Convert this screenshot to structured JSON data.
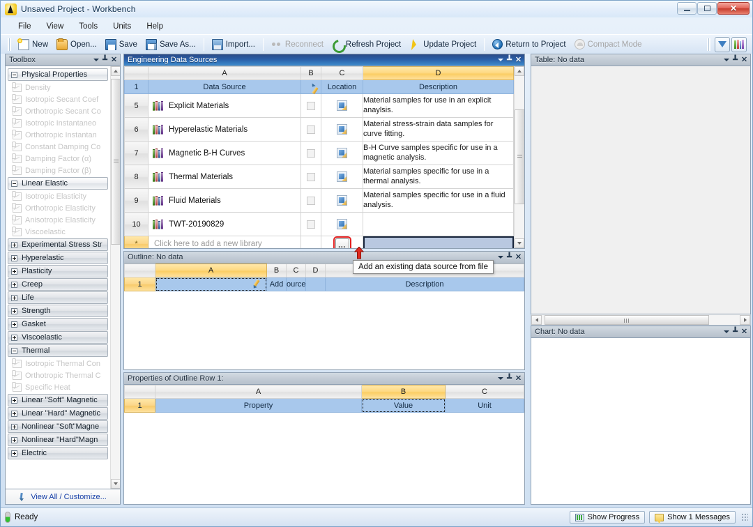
{
  "window": {
    "title": "Unsaved Project - Workbench",
    "app_icon": "workbench-logo-icon",
    "minimize": "minimize-icon",
    "maximize": "maximize-icon",
    "close": "✕"
  },
  "menu": {
    "items": [
      "File",
      "View",
      "Tools",
      "Units",
      "Help"
    ]
  },
  "toolbar": {
    "buttons": [
      {
        "label": "New",
        "icon": "new-document-icon",
        "disabled": false
      },
      {
        "label": "Open...",
        "icon": "open-folder-icon",
        "disabled": false
      },
      {
        "label": "Save",
        "icon": "save-disk-icon",
        "disabled": false
      },
      {
        "label": "Save As...",
        "icon": "save-as-icon",
        "disabled": false
      },
      {
        "label": "Import...",
        "icon": "import-icon",
        "disabled": false
      },
      {
        "label": "Reconnect",
        "icon": "reconnect-icon",
        "disabled": true
      },
      {
        "label": "Refresh Project",
        "icon": "refresh-icon",
        "disabled": false
      },
      {
        "label": "Update Project",
        "icon": "update-lightning-icon",
        "disabled": false
      },
      {
        "label": "Return to Project",
        "icon": "return-arrow-icon",
        "disabled": false
      },
      {
        "label": "Compact Mode",
        "icon": "compact-mode-icon",
        "disabled": true
      }
    ],
    "toggles": [
      {
        "name": "filter-toggle",
        "icon": "filter-funnel-icon"
      },
      {
        "name": "engineering-data-toggle",
        "icon": "books-icon"
      }
    ]
  },
  "toolbox": {
    "title": "Toolbox",
    "groups": [
      {
        "label": "Physical Properties",
        "expanded": true,
        "selected": true,
        "items": [
          "Density",
          "Isotropic Secant Coef",
          "Orthotropic Secant Co",
          "Isotropic Instantaneo",
          "Orthotropic Instantan",
          "Constant Damping Co",
          "Damping Factor (α)",
          "Damping Factor (β)"
        ]
      },
      {
        "label": "Linear Elastic",
        "expanded": true,
        "selected": true,
        "items": [
          "Isotropic Elasticity",
          "Orthotropic Elasticity",
          "Anisotropic Elasticity",
          "Viscoelastic"
        ]
      },
      {
        "label": "Experimental Stress Str",
        "expanded": false,
        "items": []
      },
      {
        "label": "Hyperelastic",
        "expanded": false,
        "items": []
      },
      {
        "label": "Plasticity",
        "expanded": false,
        "items": []
      },
      {
        "label": "Creep",
        "expanded": false,
        "items": []
      },
      {
        "label": "Life",
        "expanded": false,
        "items": []
      },
      {
        "label": "Strength",
        "expanded": false,
        "items": []
      },
      {
        "label": "Gasket",
        "expanded": false,
        "items": []
      },
      {
        "label": "Viscoelastic",
        "expanded": false,
        "items": []
      },
      {
        "label": "Thermal",
        "expanded": true,
        "items": [
          "Isotropic Thermal Con",
          "Orthotropic Thermal C",
          "Specific Heat"
        ]
      },
      {
        "label": "Linear \"Soft\" Magnetic",
        "expanded": false,
        "items": []
      },
      {
        "label": "Linear \"Hard\" Magnetic",
        "expanded": false,
        "items": []
      },
      {
        "label": "Nonlinear \"Soft\"Magne",
        "expanded": false,
        "items": []
      },
      {
        "label": "Nonlinear \"Hard\"Magn",
        "expanded": false,
        "items": []
      },
      {
        "label": "Electric",
        "expanded": false,
        "items": []
      }
    ],
    "footer_link": "View All / Customize..."
  },
  "data_sources_panel": {
    "title": "Engineering Data Sources",
    "column_headers": [
      "",
      "A",
      "B",
      "C",
      "D"
    ],
    "accent_column": "D",
    "header_row": {
      "index": "1",
      "a": "Data Source",
      "b": "pencil-icon",
      "c": "Location",
      "d": "Description"
    },
    "rows": [
      {
        "index": "5",
        "name": "Explicit Materials",
        "checked": false,
        "location": "location-icon",
        "description": "Material samples for use in an explicit anaylsis."
      },
      {
        "index": "6",
        "name": "Hyperelastic Materials",
        "checked": false,
        "location": "location-icon",
        "description": "Material stress-strain data samples for curve fitting."
      },
      {
        "index": "7",
        "name": "Magnetic B-H Curves",
        "checked": false,
        "location": "location-icon",
        "description": "B-H Curve samples specific for use in a magnetic analysis."
      },
      {
        "index": "8",
        "name": "Thermal Materials",
        "checked": false,
        "location": "location-icon",
        "description": "Material samples specific for use in a thermal analysis."
      },
      {
        "index": "9",
        "name": "Fluid Materials",
        "checked": false,
        "location": "location-icon",
        "description": "Material samples specific for use in a fluid analysis."
      },
      {
        "index": "10",
        "name": "TWT-20190829",
        "checked": false,
        "location": "location-icon",
        "description": ""
      }
    ],
    "new_row": {
      "index": "*",
      "placeholder": "Click here to add a new library",
      "browse_button": "...",
      "highlighted": true
    }
  },
  "tooltip": {
    "text": "Add an existing data source from file"
  },
  "outline_panel": {
    "title": "Outline: No data",
    "column_headers": [
      "",
      "A",
      "B",
      "C",
      "D",
      ""
    ],
    "accent_column": "A",
    "header_row": {
      "index": "1",
      "a": "",
      "b": "Add",
      "c": "ource",
      "d": "Description"
    }
  },
  "properties_panel": {
    "title": "Properties of Outline Row 1:",
    "column_headers": [
      "",
      "A",
      "B",
      "C"
    ],
    "accent_column": "B",
    "header_row": {
      "index": "1",
      "a": "Property",
      "b": "Value",
      "c": "Unit"
    }
  },
  "table_panel": {
    "title": "Table: No data"
  },
  "chart_panel": {
    "title": "Chart: No data"
  },
  "statusbar": {
    "status": "Ready",
    "progress_button": "Show Progress",
    "messages_button": "Show 1 Messages"
  },
  "colors": {
    "title_active": "#2a5fa8",
    "accent_column": "#fbcd62",
    "header_row_blue": "#a8c8ec",
    "highlight_red": "#e32222",
    "selection_blue": "#b9c8e0",
    "link_blue": "#1740a8"
  }
}
